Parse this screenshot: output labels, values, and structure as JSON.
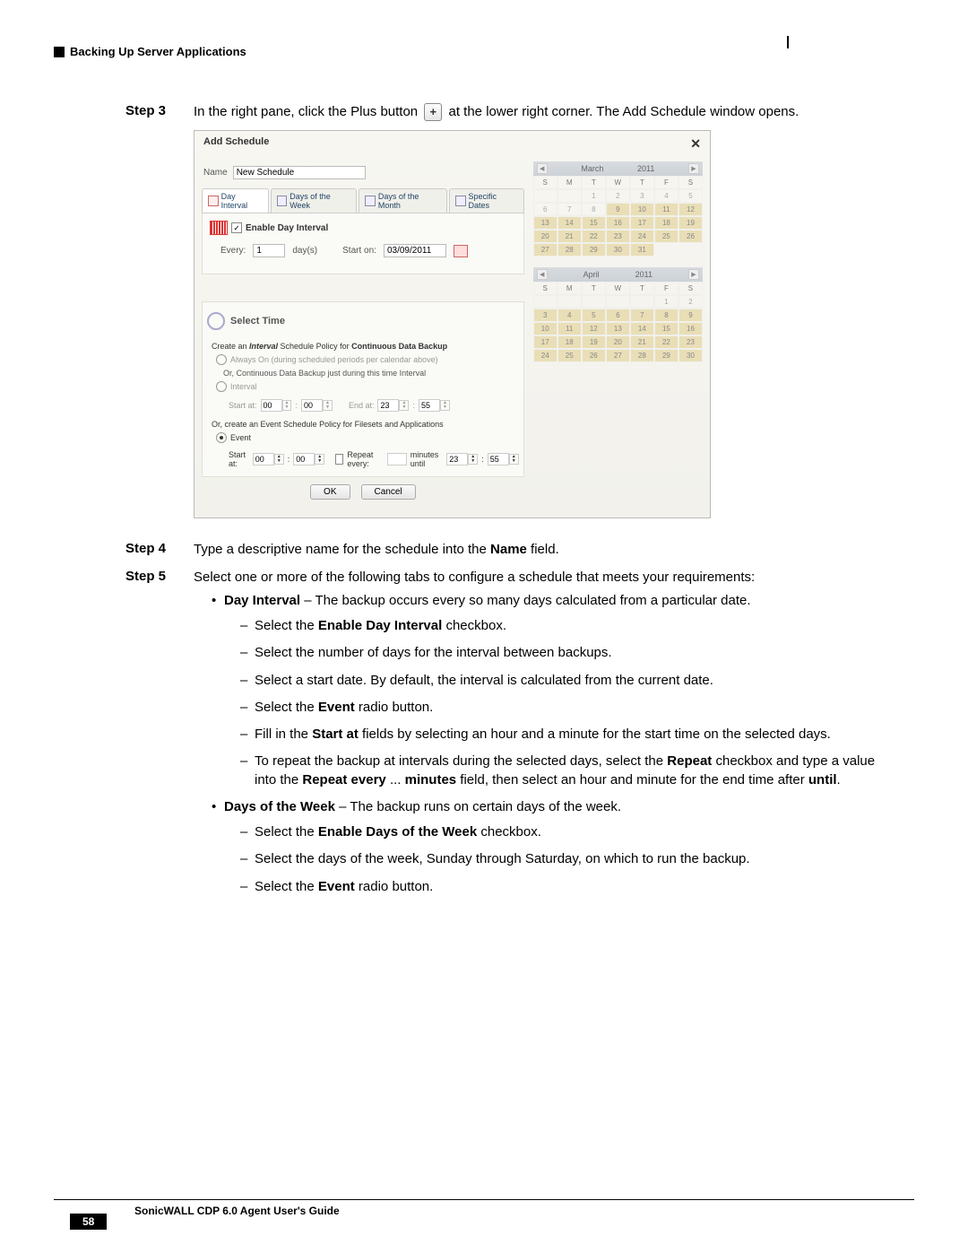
{
  "header": {
    "title": "Backing Up Server Applications"
  },
  "step3": {
    "label": "Step 3",
    "text_before": "In the right pane, click the Plus button",
    "text_after": "at the lower right corner. The Add Schedule window opens."
  },
  "dialog": {
    "title": "Add Schedule",
    "name_label": "Name",
    "name_value": "New Schedule",
    "tabs": {
      "day_interval": "Day Interval",
      "days_week": "Days of the Week",
      "days_month": "Days of the Month",
      "specific": "Specific Dates"
    },
    "enable_chk": "Enable Day Interval",
    "every_label": "Every:",
    "every_val": "1",
    "every_unit": "day(s)",
    "start_on_label": "Start on:",
    "start_on_val": "03/09/2011",
    "select_time": "Select Time",
    "create_line_a": "Create an ",
    "create_line_b": "Interval",
    "create_line_c": " Schedule Policy for ",
    "create_line_d": "Continuous Data Backup",
    "always_on": "Always On (during scheduled periods per calendar above)",
    "or_cont": "Or, Continuous Data Backup just during this time Interval",
    "interval_radio": "Interval",
    "start_at": "Start at:",
    "end_at": "End at:",
    "or_event": "Or, create an Event Schedule Policy for Filesets and Applications",
    "event_radio": "Event",
    "repeat_lbl": "Repeat every:",
    "minutes_until": "minutes until",
    "spin00": "00",
    "spin23": "23",
    "spin55": "55",
    "ok": "OK",
    "cancel": "Cancel",
    "cal1": {
      "month": "March",
      "year": "2011"
    },
    "cal2": {
      "month": "April",
      "year": "2011"
    },
    "dayhead": [
      "S",
      "M",
      "T",
      "W",
      "T",
      "F",
      "S"
    ]
  },
  "step4": {
    "label": "Step 4",
    "text_a": "Type a descriptive name for the schedule into the ",
    "bold": "Name",
    "text_b": " field."
  },
  "step5": {
    "label": "Step 5",
    "text": "Select one or more of the following tabs to configure a schedule that meets your requirements:",
    "b1": {
      "bold": "Day Interval",
      "rest": " – The backup occurs every so many days calculated from a particular date.",
      "d1_a": "Select the ",
      "d1_b": "Enable Day Interval",
      "d1_c": " checkbox.",
      "d2": "Select the number of days for the interval between backups.",
      "d3": "Select a start date. By default, the interval is calculated from the current date.",
      "d4_a": "Select the ",
      "d4_b": "Event",
      "d4_c": " radio button.",
      "d5_a": "Fill in the ",
      "d5_b": "Start at",
      "d5_c": " fields by selecting an hour and a minute for the start time on the selected days.",
      "d6_a": "To repeat the backup at intervals during the selected days, select the ",
      "d6_b": "Repeat",
      "d6_c": " checkbox and type a value into the ",
      "d6_d": "Repeat every",
      "d6_e": " ... ",
      "d6_f": "minutes",
      "d6_g": " field, then select an hour and minute for the end time after ",
      "d6_h": "until",
      "d6_i": "."
    },
    "b2": {
      "bold": "Days of the Week",
      "rest": " – The backup runs on certain days of the week.",
      "d1_a": "Select the ",
      "d1_b": "Enable Days of the Week",
      "d1_c": " checkbox.",
      "d2": "Select the days of the week, Sunday through Saturday, on which to run the backup.",
      "d3_a": "Select the ",
      "d3_b": "Event",
      "d3_c": " radio button."
    }
  },
  "footer": {
    "guide": "SonicWALL CDP 6.0 Agent User's Guide",
    "page": "58"
  }
}
